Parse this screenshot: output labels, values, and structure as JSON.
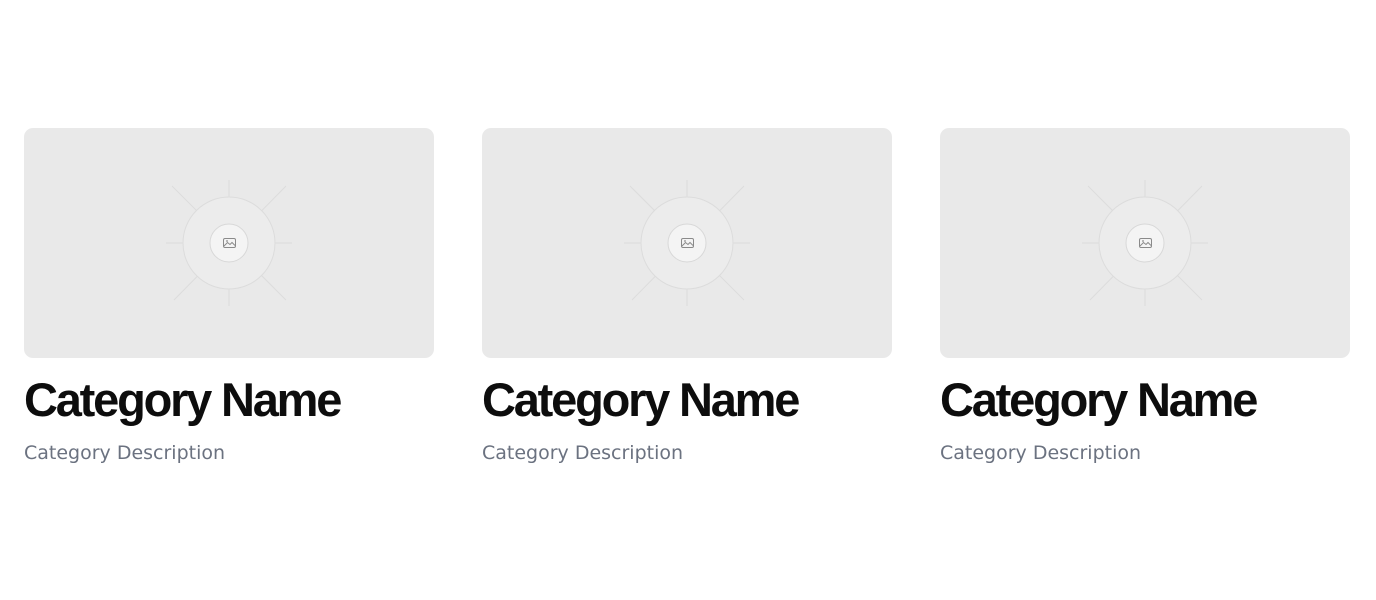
{
  "categories": [
    {
      "name": "Category Name",
      "description": "Category Description",
      "image_icon": "image-placeholder-icon"
    },
    {
      "name": "Category Name",
      "description": "Category Description",
      "image_icon": "image-placeholder-icon"
    },
    {
      "name": "Category Name",
      "description": "Category Description",
      "image_icon": "image-placeholder-icon"
    }
  ],
  "colors": {
    "placeholder_bg": "#e9e9e9",
    "title": "#0d0d0d",
    "description": "#6b7280"
  }
}
